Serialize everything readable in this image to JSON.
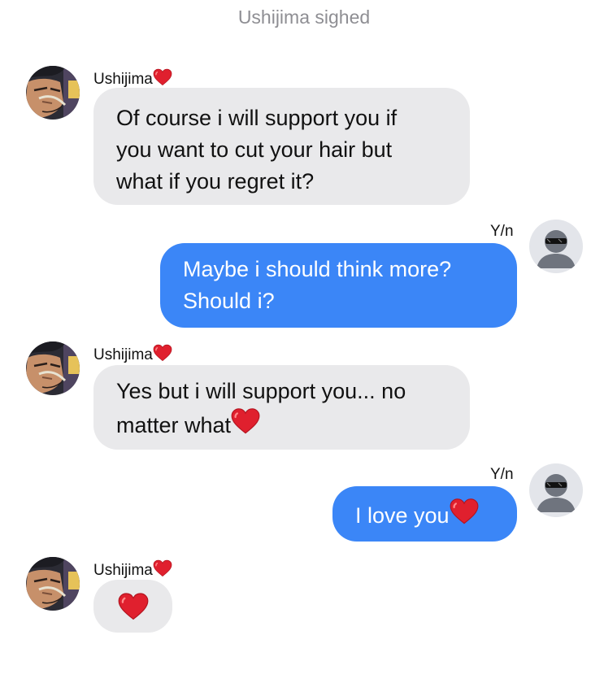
{
  "narration": "Ushijima sighed",
  "heart_emoji": "❤️",
  "colors": {
    "incoming_bubble": "#e9e9eb",
    "outgoing_bubble": "#3b86f7",
    "narration_text": "#8e8e93",
    "heart": "#e0202e"
  },
  "messages": [
    {
      "sender": "Ushijima",
      "direction": "incoming",
      "line1": "Of course i will support you if",
      "line2": "you want to cut your hair but",
      "line3": "what if you regret it?"
    },
    {
      "sender": "Y/n",
      "direction": "outgoing",
      "line1": "Maybe i should think more?",
      "line2": "Should i?"
    },
    {
      "sender": "Ushijima",
      "direction": "incoming",
      "line1": "Yes but i will support you... no",
      "line2": "matter what"
    },
    {
      "sender": "Y/n",
      "direction": "outgoing",
      "line1": "I love you"
    },
    {
      "sender": "Ushijima",
      "direction": "incoming",
      "line1": ""
    }
  ],
  "icons": {
    "ushijima_avatar": "anime-character-avatar-icon",
    "yn_avatar": "sunglasses-silhouette-avatar-icon",
    "heart": "red-heart-icon"
  }
}
